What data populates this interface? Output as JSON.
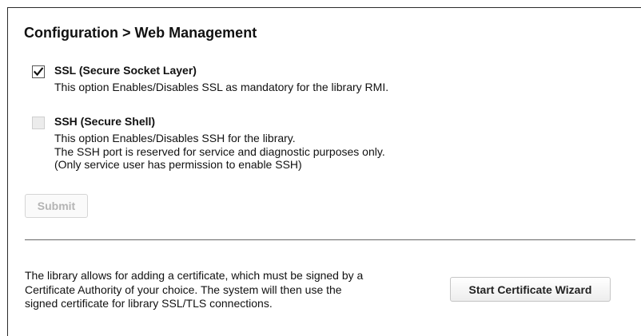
{
  "page": {
    "title": "Configuration > Web Management"
  },
  "options": [
    {
      "title": "SSL (Secure Socket Layer)",
      "checked": true,
      "enabled": true,
      "description": [
        "This option Enables/Disables SSL as mandatory for the library RMI."
      ]
    },
    {
      "title": "SSH (Secure Shell)",
      "checked": false,
      "enabled": false,
      "description": [
        "This option Enables/Disables SSH for the library.",
        "The SSH port is reserved for service and diagnostic purposes only.",
        "(Only service user has permission to enable SSH)"
      ]
    }
  ],
  "buttons": {
    "submit": "Submit",
    "start_wizard": "Start Certificate Wizard"
  },
  "certificate": {
    "lines": [
      "The library allows for adding a certificate, which must be signed by a",
      "Certificate Authority of your choice. The system will then use the",
      "signed certificate for library SSL/TLS connections."
    ]
  },
  "icons": {
    "ssl_checkbox": "checkmark-icon"
  },
  "colors": {
    "disabled_text": "#b4b4b4",
    "divider": "#666666",
    "border": "#2b2b2b"
  }
}
